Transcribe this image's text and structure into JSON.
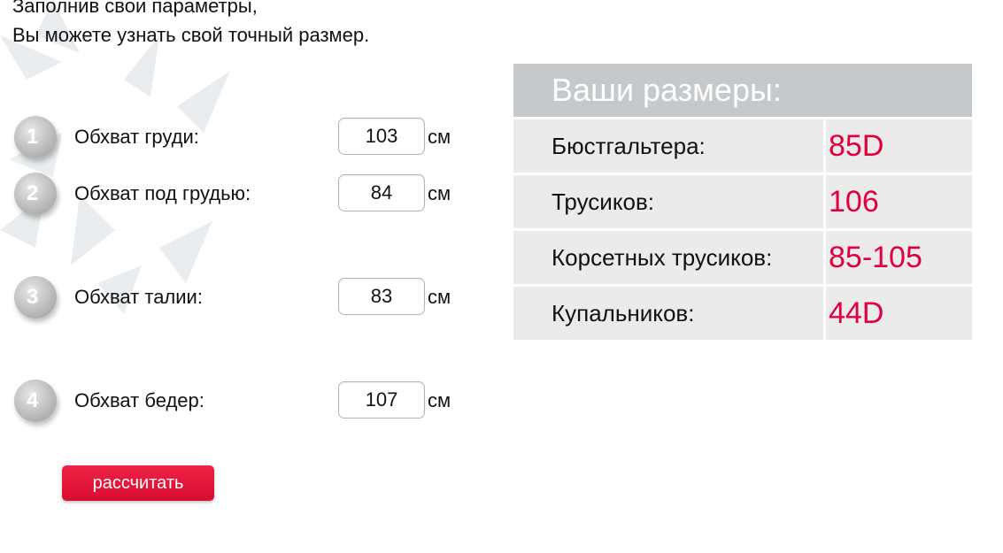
{
  "intro": {
    "line1": "Заполнив свои параметры,",
    "line2": "Вы можете узнать свой точный размер."
  },
  "fields": [
    {
      "number": "1",
      "label": "Обхват груди:",
      "value": "103",
      "unit": "см"
    },
    {
      "number": "2",
      "label": "Обхват под грудью:",
      "value": "84",
      "unit": "см"
    },
    {
      "number": "3",
      "label": "Обхват талии:",
      "value": "83",
      "unit": "см"
    },
    {
      "number": "4",
      "label": "Обхват бедер:",
      "value": "107",
      "unit": "см"
    }
  ],
  "calculate_button": "рассчитать",
  "results": {
    "title": "Ваши размеры:",
    "rows": [
      {
        "label": "Бюстгальтера:",
        "value": "85D"
      },
      {
        "label": "Трусиков:",
        "value": "106"
      },
      {
        "label": "Корсетных трусиков:",
        "value": "85-105"
      },
      {
        "label": "Купальников:",
        "value": "44D"
      }
    ]
  },
  "colors": {
    "accent": "#e0003e",
    "button": "#d80b30",
    "header_bg": "#c5c9cc",
    "row_bg": "#ebebeb"
  }
}
